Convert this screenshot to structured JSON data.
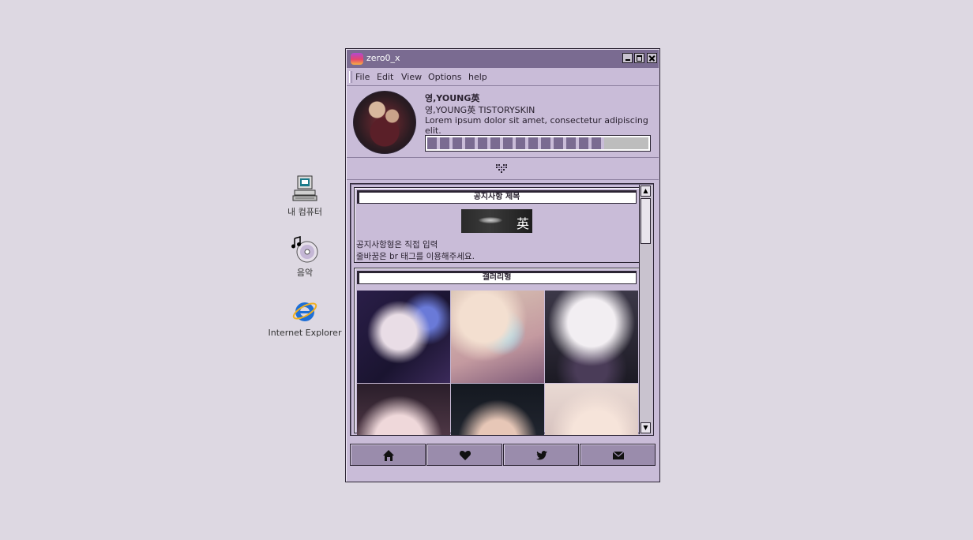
{
  "desktop": {
    "icons": [
      {
        "label": "내 컴퓨터",
        "icon": "my-computer-icon"
      },
      {
        "label": "음악",
        "icon": "music-cd-icon"
      },
      {
        "label": "Internet Explorer",
        "icon": "internet-explorer-icon"
      }
    ]
  },
  "window": {
    "title": "zero0_x",
    "menu": [
      "File",
      "Edit",
      "View",
      "Options",
      "help"
    ],
    "profile": {
      "name": "영,YOUNG英",
      "subtitle": "영,YOUNG英 TISTORYSKIN",
      "description": "Lorem ipsum dolor sit amet, consectetur adipiscing elit.",
      "progress": 0.8
    },
    "notice": {
      "title": "공지사항 제목",
      "image_glyph": "英",
      "line1": "공지사항형은 직접 입력",
      "line2": "줄바꿈은 br 태그를 이용해주세요."
    },
    "gallery": {
      "title": "갤러리형"
    },
    "footer": {
      "buttons": [
        "home-icon",
        "heart-icon",
        "twitter-icon",
        "mail-icon"
      ]
    }
  },
  "colors": {
    "desktop_bg": "#ddd8e2",
    "titlebar": "#7a6b91",
    "window_bg": "#c9bcd8",
    "footer_button": "#9a8cac"
  }
}
